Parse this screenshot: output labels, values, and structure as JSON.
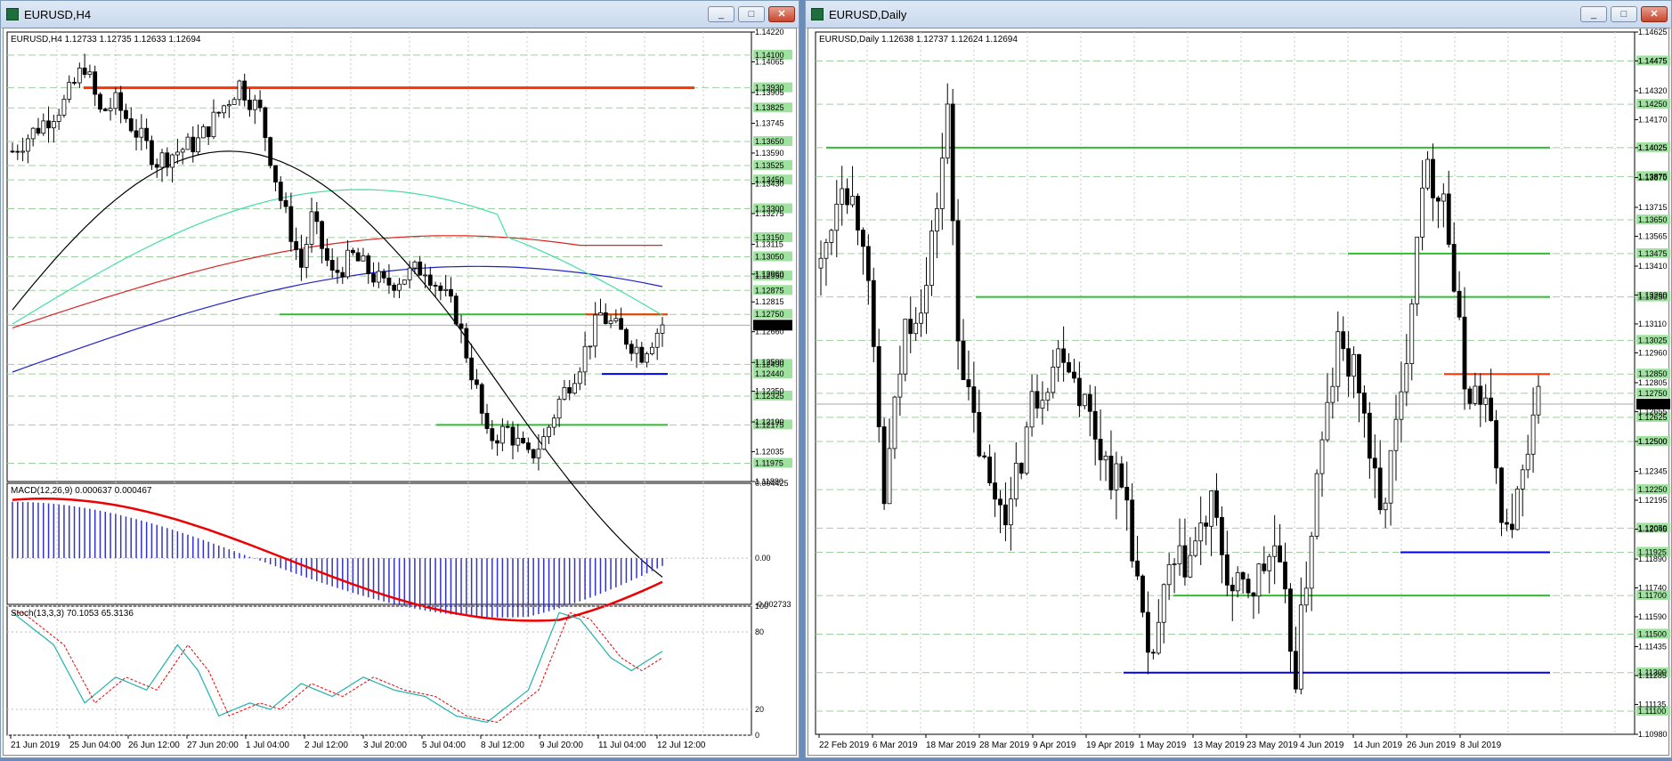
{
  "left_window": {
    "title": "EURUSD,H4",
    "info": "EURUSD,H4  1.12733 1.12735 1.12633 1.12694",
    "macd_label": "MACD(12,26,9) 0.000637 0.000467",
    "stoch_label": "Stoch(13,3,3) 70.1053 65.3136",
    "price_ticks": [
      "1.14220",
      "1.14065",
      "1.13905",
      "1.13745",
      "1.13590",
      "1.13430",
      "1.13275",
      "1.13115",
      "1.12960",
      "1.12815",
      "1.12660",
      "1.12500",
      "1.12350",
      "1.12190",
      "1.12035",
      "1.11880"
    ],
    "level_labels": [
      "1.14100",
      "1.13930",
      "1.13825",
      "1.13650",
      "1.13525",
      "1.13450",
      "1.13300",
      "1.13150",
      "1.13050",
      "1.12950",
      "1.12875",
      "1.12750",
      "1.12490",
      "1.12440",
      "1.12325",
      "1.12175",
      "1.11975"
    ],
    "current_price": "1.12694",
    "macd_ticks": [
      "0.004425",
      "0.00",
      "-0.002733"
    ],
    "stoch_ticks": [
      "100",
      "80",
      "20",
      "0"
    ],
    "time_labels": [
      "21 Jun 2019",
      "25 Jun 04:00",
      "26 Jun 12:00",
      "27 Jun 20:00",
      "1 Jul 04:00",
      "2 Jul 12:00",
      "3 Jul 20:00",
      "5 Jul 04:00",
      "8 Jul 12:00",
      "9 Jul 20:00",
      "11 Jul 04:00",
      "12 Jul 12:00"
    ]
  },
  "right_window": {
    "title": "EURUSD,Daily",
    "info": "EURUSD,Daily  1.12638 1.12737 1.12624 1.12694",
    "price_ticks": [
      "1.14625",
      "1.14475",
      "1.14320",
      "1.14170",
      "1.14025",
      "1.13870",
      "1.13715",
      "1.13565",
      "1.13410",
      "1.13260",
      "1.13110",
      "1.12960",
      "1.12805",
      "1.12655",
      "1.12500",
      "1.12345",
      "1.12195",
      "1.12045",
      "1.11890",
      "1.11740",
      "1.11590",
      "1.11435",
      "1.11285",
      "1.11135",
      "1.10980"
    ],
    "level_labels": [
      "1.14475",
      "1.14250",
      "1.14025",
      "1.13875",
      "1.13650",
      "1.13475",
      "1.13250",
      "1.13025",
      "1.12850",
      "1.12750",
      "1.12625",
      "1.12500",
      "1.12250",
      "1.12050",
      "1.11925",
      "1.11700",
      "1.11500",
      "1.11300",
      "1.11100"
    ],
    "current_price": "1.12694",
    "time_labels": [
      "22 Feb 2019",
      "6 Mar 2019",
      "18 Mar 2019",
      "28 Mar 2019",
      "9 Apr 2019",
      "19 Apr 2019",
      "1 May 2019",
      "13 May 2019",
      "23 May 2019",
      "4 Jun 2019",
      "14 Jun 2019",
      "26 Jun 2019",
      "8 Jul 2019"
    ]
  },
  "buttons": {
    "minimize": "_",
    "maximize": "□",
    "close": "✕"
  },
  "colors": {
    "resistance": "#ff3300",
    "support_green": "#33bb33",
    "support_blue": "#0000ee",
    "grid": "#9fcf9f",
    "macd_hist": "#3333cc",
    "macd_signal": "#ee0000",
    "stoch_main": "#20b2aa",
    "stoch_signal": "#ee0000"
  }
}
